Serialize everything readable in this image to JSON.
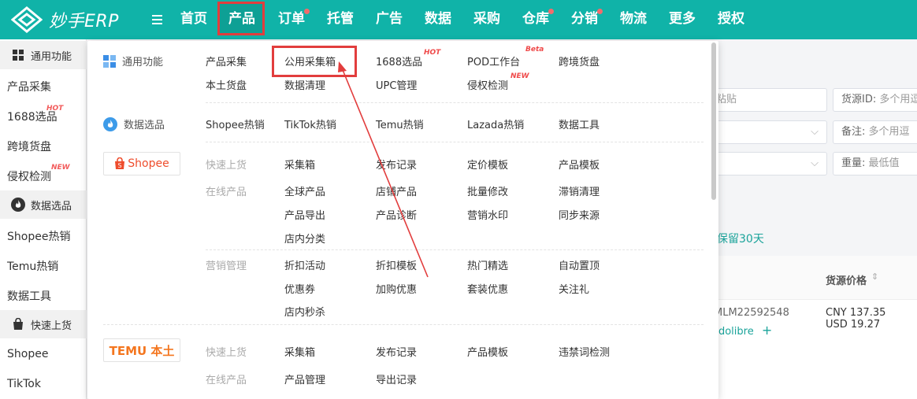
{
  "app": {
    "name": "妙手ERP"
  },
  "nav": {
    "items": [
      {
        "label": "首页",
        "dot": false
      },
      {
        "label": "产品",
        "dot": false,
        "active": true
      },
      {
        "label": "订单",
        "dot": true
      },
      {
        "label": "托管",
        "dot": false
      },
      {
        "label": "广告",
        "dot": false
      },
      {
        "label": "数据",
        "dot": false
      },
      {
        "label": "采购",
        "dot": false
      },
      {
        "label": "仓库",
        "dot": true
      },
      {
        "label": "分销",
        "dot": true
      },
      {
        "label": "物流",
        "dot": false
      },
      {
        "label": "更多",
        "dot": false
      },
      {
        "label": "授权",
        "dot": false
      }
    ]
  },
  "sidebar": {
    "group_general": "通用功能",
    "item_collect": "产品采集",
    "item_1688": "1688选品",
    "item_1688_badge": "HOT",
    "item_cross": "跨境货盘",
    "item_infringe": "侵权检测",
    "item_infringe_badge": "NEW",
    "group_data": "数据选品",
    "item_shopee_hot": "Shopee热销",
    "item_temu_hot": "Temu热销",
    "item_data_tools": "数据工具",
    "group_quick": "快速上货",
    "item_shopee": "Shopee",
    "item_tiktok": "TikTok"
  },
  "background": {
    "paste_placeholder": "粘贴",
    "source_id_label": "货源ID:",
    "source_id_placeholder": "多个用逗",
    "remark_label": "备注:",
    "remark_placeholder": "多个用逗",
    "weight_label": "重量:",
    "weight_placeholder": "最低值",
    "retention_text": "双保留30天",
    "price_col_header": "货源价格",
    "row_id": "MLM22592548",
    "row_source": "adolibre",
    "row_price_cny": "CNY 137.35",
    "row_price_usd": "USD 19.27"
  },
  "dropdown": {
    "sec_general": "通用功能",
    "sec_data": "数据选品",
    "brand_shopee": "Shopee",
    "brand_temu": "TEMU 本土",
    "general": {
      "row1": [
        "产品采集",
        "公用采集箱",
        "1688选品",
        "POD工作台",
        "跨境货盘"
      ],
      "row2": [
        "本土货盘",
        "数据清理",
        "UPC管理",
        "侵权检测"
      ],
      "tag_1688": "HOT",
      "tag_pod": "Beta",
      "tag_infringe": "NEW"
    },
    "data": [
      "Shopee热销",
      "TikTok热销",
      "Temu热销",
      "Lazada热销",
      "数据工具"
    ],
    "shopee": {
      "cat_quick": "快速上货",
      "quick": [
        "采集箱",
        "发布记录",
        "定价模板",
        "产品模板"
      ],
      "cat_online": "在线产品",
      "online_r1": [
        "全球产品",
        "店铺产品",
        "批量修改",
        "滞销清理"
      ],
      "online_r2": [
        "产品导出",
        "产品诊断",
        "营销水印",
        "同步来源"
      ],
      "online_r3": [
        "店内分类"
      ],
      "cat_marketing": "营销管理",
      "mkt_r1": [
        "折扣活动",
        "折扣模板",
        "热门精选",
        "自动置顶"
      ],
      "mkt_r2": [
        "优惠券",
        "加购优惠",
        "套装优惠",
        "关注礼"
      ],
      "mkt_r3": [
        "店内秒杀"
      ]
    },
    "temu": {
      "cat_quick": "快速上货",
      "quick": [
        "采集箱",
        "发布记录",
        "产品模板",
        "违禁词检测"
      ],
      "cat_online": "在线产品",
      "online": [
        "产品管理",
        "导出记录"
      ]
    }
  },
  "colors": {
    "brand": "#10b3a8",
    "highlight": "#e23d3d",
    "shopee": "#ee4d2d",
    "temu": "#f4761f",
    "link": "#1aa39a"
  }
}
